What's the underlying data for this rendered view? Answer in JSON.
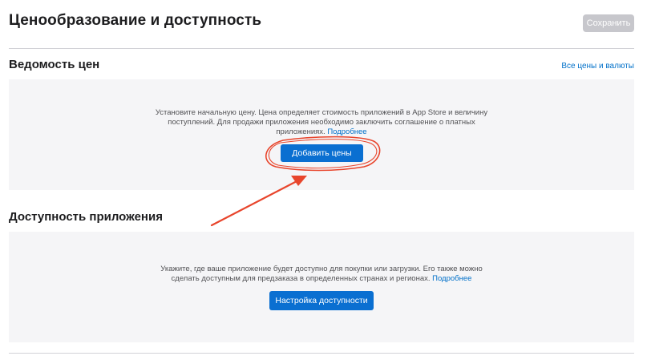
{
  "header": {
    "title": "Ценообразование и доступность",
    "save_label": "Сохранить"
  },
  "pricing": {
    "title": "Ведомость цен",
    "link_label": "Все цены и валюты",
    "description_line1": "Установите начальную цену. Цена определяет стоимость приложений в App Store и величину",
    "description_line2": "поступлений. Для продажи приложения необходимо заключить соглашение о платных",
    "description_line3": "приложениях.",
    "more_link": "Подробнее",
    "add_button": "Добавить цены"
  },
  "availability": {
    "title": "Доступность приложения",
    "description_line1": "Укажите, где ваше приложение будет доступно для покупки или загрузки. Его также можно",
    "description_line2": "сделать доступным для предзаказа в определенных странах и регионах.",
    "more_link": "Подробнее",
    "setup_button": "Настройка доступности"
  },
  "colors": {
    "accent": "#0a6fd1",
    "link": "#0070c9",
    "annotation": "#e8452c",
    "panel": "#f5f5f7",
    "save_disabled": "#c7c7cc"
  }
}
